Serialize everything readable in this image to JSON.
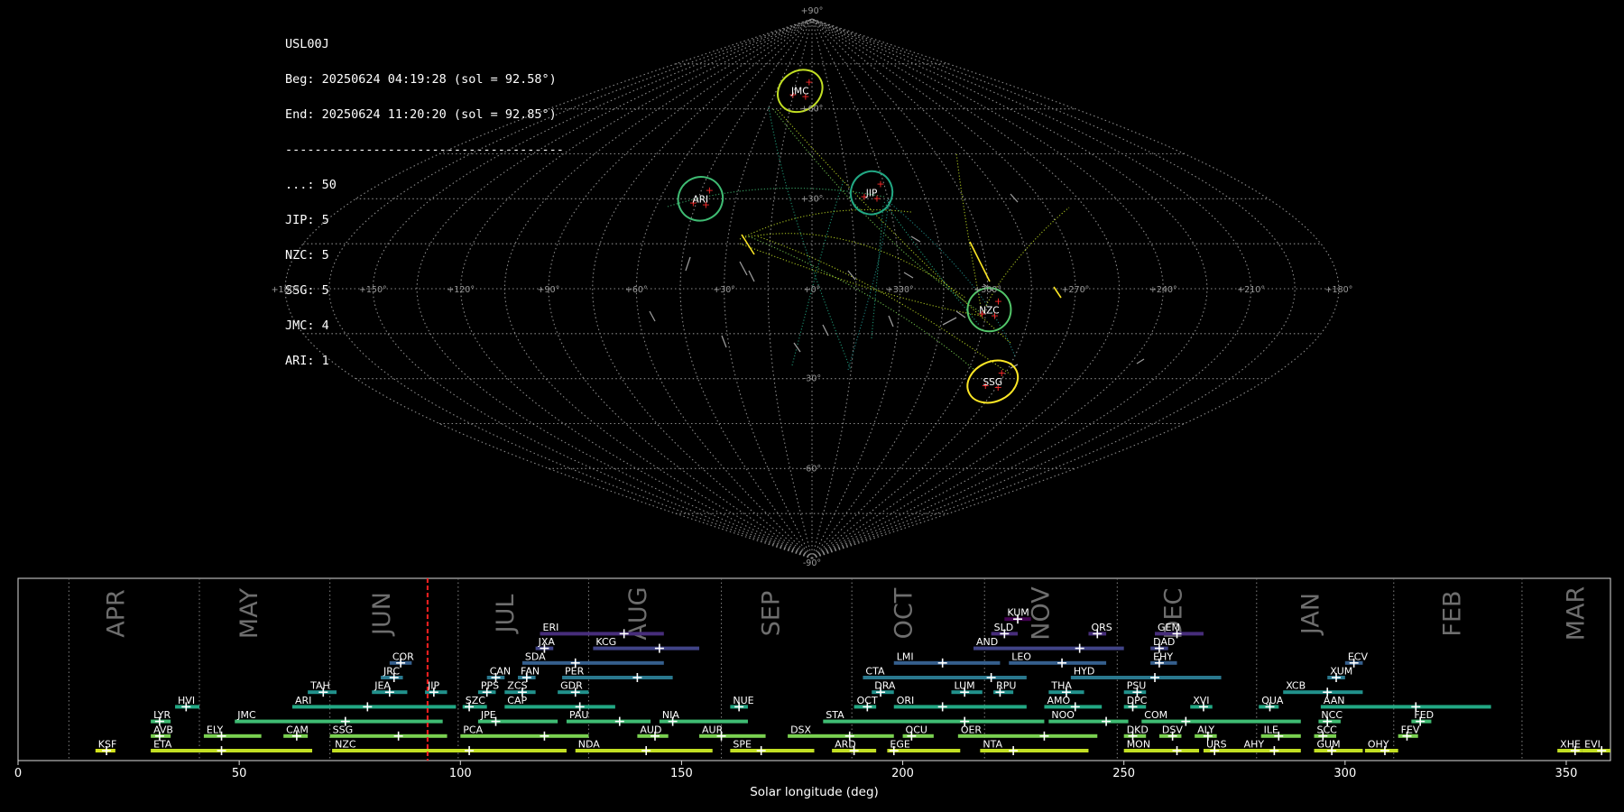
{
  "info": {
    "station": "USL00J",
    "beg": "Beg: 20250624 04:19:28 (sol = 92.58°)",
    "end": "End: 20250624 11:20:20 (sol = 92.85°)",
    "separator": "--------------------------------------",
    "counts": [
      {
        "label": "...: 50"
      },
      {
        "label": "JIP: 5"
      },
      {
        "label": "NZC: 5"
      },
      {
        "label": "SSG: 5"
      },
      {
        "label": "JMC: 4"
      },
      {
        "label": "ARI: 1"
      }
    ]
  },
  "sky_map": {
    "projection": "sinusoidal",
    "lon_ticks": [
      "+180°",
      "+150°",
      "+120°",
      "+90°",
      "+60°",
      "+30°",
      "+0°",
      "+330°",
      "+300°",
      "+270°",
      "+240°",
      "+210°",
      "+180°"
    ],
    "lat_ticks": [
      {
        "lat": 90,
        "label": "+90°"
      },
      {
        "lat": 60,
        "label": "+60°"
      },
      {
        "lat": 30,
        "label": "+30°"
      },
      {
        "lat": -30,
        "label": "-30°"
      },
      {
        "lat": -60,
        "label": "-60°"
      },
      {
        "lat": -90,
        "label": "-90°"
      }
    ],
    "showers": [
      {
        "code": "JMC",
        "lon": 10,
        "lat": 66,
        "color": "#c2df23",
        "rx": 26,
        "ry": 22,
        "rot": -35
      },
      {
        "code": "ARI",
        "lon": 44,
        "lat": 30,
        "color": "#3fbc73",
        "rx": 25,
        "ry": 24,
        "rot": -30
      },
      {
        "code": "JIP",
        "lon": 336,
        "lat": 32,
        "color": "#22a884",
        "rx": 23,
        "ry": 24,
        "rot": 20
      },
      {
        "code": "NZC",
        "lon": 299,
        "lat": -7,
        "color": "#52c569",
        "rx": 24,
        "ry": 24,
        "rot": 0
      },
      {
        "code": "SSG",
        "lon": 288,
        "lat": -31,
        "color": "#fde725",
        "rx": 29,
        "ry": 22,
        "rot": -25
      }
    ]
  },
  "chart_data": {
    "type": "bar",
    "title": "",
    "xlabel": "Solar longitude (deg)",
    "ylabel": "",
    "xlim": [
      0,
      360
    ],
    "x_ticks": [
      0,
      50,
      100,
      150,
      200,
      250,
      300,
      350
    ],
    "current_sol": 92.58,
    "months": [
      {
        "name": "APR",
        "start": 11.5,
        "label_at": 24
      },
      {
        "name": "MAY",
        "start": 41,
        "label_at": 54
      },
      {
        "name": "JUN",
        "start": 70.5,
        "label_at": 84
      },
      {
        "name": "JUL",
        "start": 99.5,
        "label_at": 112
      },
      {
        "name": "AUG",
        "start": 129,
        "label_at": 142
      },
      {
        "name": "SEP",
        "start": 159,
        "label_at": 172
      },
      {
        "name": "OCT",
        "start": 188.5,
        "label_at": 202
      },
      {
        "name": "NOV",
        "start": 218.5,
        "label_at": 233
      },
      {
        "name": "DEC",
        "start": 248.5,
        "label_at": 263
      },
      {
        "name": "JAN",
        "start": 280,
        "label_at": 294
      },
      {
        "name": "FEB",
        "start": 311,
        "label_at": 326
      },
      {
        "name": "MAR",
        "start": 340,
        "label_at": 354
      }
    ],
    "showers": [
      {
        "code": "KSF",
        "start": 17.5,
        "end": 22,
        "peak": 20,
        "row": 0,
        "color": "#d2e21b"
      },
      {
        "code": "ETA",
        "start": 30,
        "end": 66.5,
        "peak": 46,
        "row": 0,
        "color": "#c2df23"
      },
      {
        "code": "NZC",
        "start": 71,
        "end": 124,
        "peak": 102,
        "row": 0,
        "color": "#c2df23"
      },
      {
        "code": "NDA",
        "start": 126,
        "end": 157,
        "peak": 142,
        "row": 0,
        "color": "#c2df23"
      },
      {
        "code": "SPE",
        "start": 161,
        "end": 180,
        "peak": 168,
        "row": 0,
        "color": "#c2df23"
      },
      {
        "code": "ARD",
        "start": 184,
        "end": 194,
        "peak": 189,
        "row": 0,
        "color": "#c2df23"
      },
      {
        "code": "EGE",
        "start": 196.5,
        "end": 213,
        "peak": 198,
        "row": 0,
        "color": "#c2df23"
      },
      {
        "code": "NTA",
        "start": 217.5,
        "end": 242,
        "peak": 225,
        "row": 0,
        "color": "#c2df23"
      },
      {
        "code": "MON",
        "start": 250,
        "end": 267,
        "peak": 262,
        "row": 0,
        "color": "#c2df23"
      },
      {
        "code": "URS",
        "start": 268,
        "end": 277,
        "peak": 270.5,
        "row": 0,
        "color": "#c2df23"
      },
      {
        "code": "AHY",
        "start": 276.5,
        "end": 290,
        "peak": 284,
        "row": 0,
        "color": "#c2df23"
      },
      {
        "code": "GUM",
        "start": 293,
        "end": 304,
        "peak": 297,
        "row": 0,
        "color": "#c2df23"
      },
      {
        "code": "OHY",
        "start": 304.5,
        "end": 312,
        "peak": 309,
        "row": 0,
        "color": "#c2df23"
      },
      {
        "code": "XHE",
        "start": 348,
        "end": 353.5,
        "peak": 352,
        "row": 0,
        "color": "#c2df23"
      },
      {
        "code": "EVI",
        "start": 353.5,
        "end": 360,
        "peak": 358,
        "row": 0,
        "color": "#c2df23"
      },
      {
        "code": "AVB",
        "start": 30,
        "end": 34.5,
        "peak": 32,
        "row": 1,
        "color": "#7ad151"
      },
      {
        "code": "ELY",
        "start": 42,
        "end": 55,
        "peak": 46,
        "row": 1,
        "color": "#7ad151"
      },
      {
        "code": "CAM",
        "start": 60,
        "end": 65.5,
        "peak": 63,
        "row": 1,
        "color": "#7ad151"
      },
      {
        "code": "SSG",
        "start": 70.5,
        "end": 97,
        "peak": 86,
        "row": 1,
        "color": "#7ad151"
      },
      {
        "code": "PCA",
        "start": 100,
        "end": 129,
        "peak": 119,
        "row": 1,
        "color": "#7ad151"
      },
      {
        "code": "AUD",
        "start": 140,
        "end": 147,
        "peak": 144,
        "row": 1,
        "color": "#7ad151"
      },
      {
        "code": "AUR",
        "start": 154,
        "end": 169,
        "peak": 159,
        "row": 1,
        "color": "#7ad151"
      },
      {
        "code": "DSX",
        "start": 174,
        "end": 198,
        "peak": 188,
        "row": 1,
        "color": "#7ad151"
      },
      {
        "code": "OCU",
        "start": 200,
        "end": 207,
        "peak": 202,
        "row": 1,
        "color": "#7ad151"
      },
      {
        "code": "OER",
        "start": 212.5,
        "end": 244,
        "peak": 232,
        "row": 1,
        "color": "#7ad151"
      },
      {
        "code": "DKD",
        "start": 250,
        "end": 255,
        "peak": 252,
        "row": 1,
        "color": "#7ad151"
      },
      {
        "code": "DSV",
        "start": 258,
        "end": 263,
        "peak": 261,
        "row": 1,
        "color": "#7ad151"
      },
      {
        "code": "ALY",
        "start": 266,
        "end": 271,
        "peak": 269,
        "row": 1,
        "color": "#7ad151"
      },
      {
        "code": "ILE",
        "start": 281,
        "end": 290,
        "peak": 285,
        "row": 1,
        "color": "#7ad151"
      },
      {
        "code": "SCC",
        "start": 293,
        "end": 298,
        "peak": 295,
        "row": 1,
        "color": "#7ad151"
      },
      {
        "code": "FEV",
        "start": 312,
        "end": 316.5,
        "peak": 314,
        "row": 1,
        "color": "#7ad151"
      },
      {
        "code": "LYR",
        "start": 30,
        "end": 34.5,
        "peak": 32,
        "row": 2,
        "color": "#3fbc73"
      },
      {
        "code": "JMC",
        "start": 49,
        "end": 96,
        "peak": 74,
        "row": 2,
        "color": "#3fbc73"
      },
      {
        "code": "JPE",
        "start": 104,
        "end": 122,
        "peak": 108,
        "row": 2,
        "color": "#3fbc73"
      },
      {
        "code": "PAU",
        "start": 124,
        "end": 143,
        "peak": 136,
        "row": 2,
        "color": "#3fbc73"
      },
      {
        "code": "NIA",
        "start": 145,
        "end": 165,
        "peak": 148,
        "row": 2,
        "color": "#3fbc73"
      },
      {
        "code": "STA",
        "start": 182,
        "end": 232,
        "peak": 214,
        "row": 2,
        "color": "#3fbc73"
      },
      {
        "code": "NOO",
        "start": 233,
        "end": 251,
        "peak": 246,
        "row": 2,
        "color": "#3fbc73"
      },
      {
        "code": "COM",
        "start": 254,
        "end": 290,
        "peak": 264,
        "row": 2,
        "color": "#3fbc73"
      },
      {
        "code": "NCC",
        "start": 294,
        "end": 299,
        "peak": 296,
        "row": 2,
        "color": "#3fbc73"
      },
      {
        "code": "FED",
        "start": 315,
        "end": 319.5,
        "peak": 317,
        "row": 2,
        "color": "#3fbc73"
      },
      {
        "code": "HVI",
        "start": 35.5,
        "end": 41,
        "peak": 38,
        "row": 3,
        "color": "#22a884"
      },
      {
        "code": "ARI",
        "start": 62,
        "end": 99,
        "peak": 79,
        "row": 3,
        "color": "#22a884"
      },
      {
        "code": "SZC",
        "start": 100.5,
        "end": 106,
        "peak": 102,
        "row": 3,
        "color": "#22a884"
      },
      {
        "code": "CAP",
        "start": 110,
        "end": 135,
        "peak": 127,
        "row": 3,
        "color": "#22a884"
      },
      {
        "code": "NUE",
        "start": 161,
        "end": 165,
        "peak": 163,
        "row": 3,
        "color": "#22a884"
      },
      {
        "code": "OCT",
        "start": 189,
        "end": 194,
        "peak": 192,
        "row": 3,
        "color": "#22a884"
      },
      {
        "code": "ORI",
        "start": 198,
        "end": 228,
        "peak": 209,
        "row": 3,
        "color": "#22a884"
      },
      {
        "code": "AMO",
        "start": 232,
        "end": 245,
        "peak": 239,
        "row": 3,
        "color": "#22a884"
      },
      {
        "code": "DPC",
        "start": 250,
        "end": 255,
        "peak": 252,
        "row": 3,
        "color": "#22a884"
      },
      {
        "code": "XVI",
        "start": 265,
        "end": 270,
        "peak": 268,
        "row": 3,
        "color": "#22a884"
      },
      {
        "code": "QUA",
        "start": 280.5,
        "end": 285,
        "peak": 283,
        "row": 3,
        "color": "#22a884"
      },
      {
        "code": "AAN",
        "start": 294.5,
        "end": 333,
        "peak": 316,
        "row": 3,
        "color": "#22a884"
      },
      {
        "code": "TAH",
        "start": 65.5,
        "end": 72,
        "peak": 69,
        "row": 4,
        "color": "#21918c"
      },
      {
        "code": "JEA",
        "start": 80,
        "end": 88,
        "peak": 84,
        "row": 4,
        "color": "#21918c"
      },
      {
        "code": "JIP",
        "start": 92,
        "end": 97,
        "peak": 94,
        "row": 4,
        "color": "#21918c"
      },
      {
        "code": "PPS",
        "start": 104,
        "end": 108,
        "peak": 106,
        "row": 4,
        "color": "#21918c"
      },
      {
        "code": "ZCS",
        "start": 110,
        "end": 117,
        "peak": 114,
        "row": 4,
        "color": "#21918c"
      },
      {
        "code": "GDR",
        "start": 122,
        "end": 129,
        "peak": 126,
        "row": 4,
        "color": "#21918c"
      },
      {
        "code": "DRA",
        "start": 193,
        "end": 198,
        "peak": 195,
        "row": 4,
        "color": "#21918c"
      },
      {
        "code": "LUM",
        "start": 211,
        "end": 218,
        "peak": 214,
        "row": 4,
        "color": "#21918c"
      },
      {
        "code": "RPU",
        "start": 220.5,
        "end": 225,
        "peak": 222,
        "row": 4,
        "color": "#21918c"
      },
      {
        "code": "THA",
        "start": 233,
        "end": 241,
        "peak": 237,
        "row": 4,
        "color": "#21918c"
      },
      {
        "code": "PSU",
        "start": 250,
        "end": 255,
        "peak": 253,
        "row": 4,
        "color": "#21918c"
      },
      {
        "code": "XCB",
        "start": 286,
        "end": 304,
        "peak": 296,
        "row": 4,
        "color": "#21918c"
      },
      {
        "code": "JRC",
        "start": 82,
        "end": 87,
        "peak": 85,
        "row": 5,
        "color": "#2a788e"
      },
      {
        "code": "CAN",
        "start": 106,
        "end": 110,
        "peak": 108,
        "row": 5,
        "color": "#2a788e"
      },
      {
        "code": "FAN",
        "start": 113,
        "end": 117,
        "peak": 115,
        "row": 5,
        "color": "#2a788e"
      },
      {
        "code": "PER",
        "start": 123,
        "end": 148,
        "peak": 140,
        "row": 5,
        "color": "#2a788e"
      },
      {
        "code": "CTA",
        "start": 191,
        "end": 228,
        "peak": 220,
        "row": 5,
        "color": "#2a788e"
      },
      {
        "code": "HYD",
        "start": 238,
        "end": 272,
        "peak": 257,
        "row": 5,
        "color": "#2a788e"
      },
      {
        "code": "XUM",
        "start": 296,
        "end": 300,
        "peak": 298,
        "row": 5,
        "color": "#2a788e"
      },
      {
        "code": "COR",
        "start": 84,
        "end": 89,
        "peak": 86.5,
        "row": 6,
        "color": "#355f8d"
      },
      {
        "code": "SDA",
        "start": 114,
        "end": 146,
        "peak": 126,
        "row": 6,
        "color": "#355f8d"
      },
      {
        "code": "LMI",
        "start": 198,
        "end": 222,
        "peak": 209,
        "row": 6,
        "color": "#355f8d"
      },
      {
        "code": "LEO",
        "start": 224,
        "end": 246,
        "peak": 236,
        "row": 6,
        "color": "#355f8d"
      },
      {
        "code": "EHY",
        "start": 256,
        "end": 262,
        "peak": 258,
        "row": 6,
        "color": "#355f8d"
      },
      {
        "code": "ECV",
        "start": 300,
        "end": 304,
        "peak": 302,
        "row": 6,
        "color": "#355f8d"
      },
      {
        "code": "JXA",
        "start": 117,
        "end": 121,
        "peak": 119,
        "row": 7,
        "color": "#414487"
      },
      {
        "code": "KCG",
        "start": 130,
        "end": 154,
        "peak": 145,
        "row": 7,
        "color": "#414487"
      },
      {
        "code": "AND",
        "start": 216,
        "end": 250,
        "peak": 240,
        "row": 7,
        "color": "#414487"
      },
      {
        "code": "DAD",
        "start": 256,
        "end": 260,
        "peak": 258,
        "row": 7,
        "color": "#414487"
      },
      {
        "code": "ERI",
        "start": 118,
        "end": 146,
        "peak": 137,
        "row": 8,
        "color": "#472d7b"
      },
      {
        "code": "SLD",
        "start": 220,
        "end": 226,
        "peak": 223,
        "row": 8,
        "color": "#472d7b"
      },
      {
        "code": "ORS",
        "start": 242,
        "end": 246,
        "peak": 244,
        "row": 8,
        "color": "#472d7b"
      },
      {
        "code": "GEM",
        "start": 257,
        "end": 268,
        "peak": 262,
        "row": 8,
        "color": "#472d7b"
      },
      {
        "code": "KUM",
        "start": 223,
        "end": 229,
        "peak": 226,
        "row": 9,
        "color": "#440154"
      }
    ]
  }
}
